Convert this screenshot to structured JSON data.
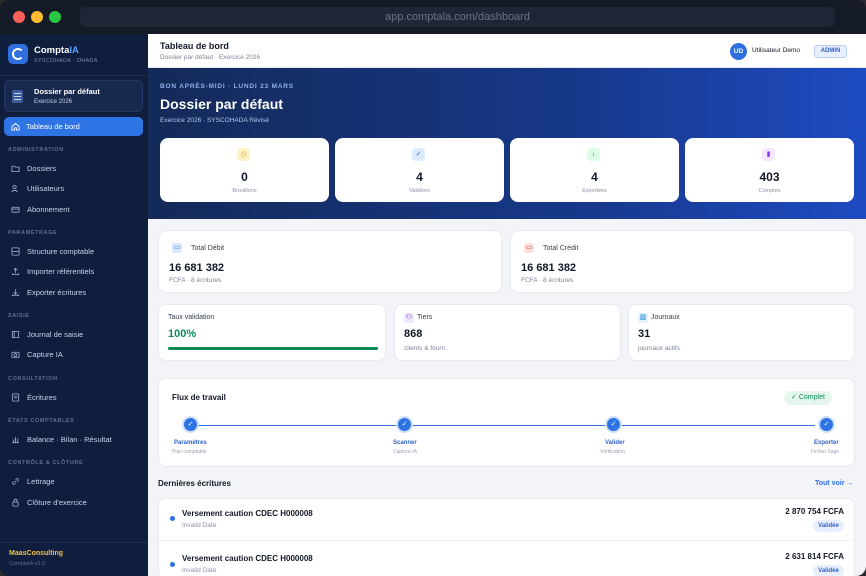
{
  "browser": {
    "url": "app.comptala.com/dashboard"
  },
  "colors": {
    "accent": "#2f74e4",
    "success": "#0b8a58",
    "brand_gold": "#f0c24a",
    "sidebar_bg": "#0f1e3d"
  },
  "sidebar": {
    "brand_name_main": "Compta",
    "brand_name_accent": "IA",
    "brand_sub": "SYSCOHADA · OHADA",
    "dossier_title": "Dossier par défaut",
    "dossier_sub": "Exercice 2026",
    "active_item": {
      "label": "Tableau de bord",
      "icon": "home-icon"
    },
    "sections": {
      "administration": "ADMINISTRATION",
      "parametrage": "PARAMÉTRAGE",
      "saisie": "SAISIE",
      "consultation": "CONSULTATION",
      "etats": "ÉTATS COMPTABLES",
      "controle": "CONTRÔLE & CLÔTURE"
    },
    "items": [
      {
        "label": "Dossiers",
        "icon": "folder-icon"
      },
      {
        "label": "Utilisateurs",
        "icon": "users-icon"
      },
      {
        "label": "Abonnement",
        "icon": "card-icon"
      },
      {
        "label": "Structure comptable",
        "icon": "structure-icon"
      },
      {
        "label": "Importer référentiels",
        "icon": "upload-icon"
      },
      {
        "label": "Exporter écritures",
        "icon": "download-icon"
      },
      {
        "label": "Journal de saisie",
        "icon": "book-icon"
      },
      {
        "label": "Capture IA",
        "icon": "camera-icon"
      },
      {
        "label": "Écritures",
        "icon": "list-icon"
      },
      {
        "label": "Balance · Bilan · Résultat",
        "icon": "chart-icon"
      },
      {
        "label": "Lettrage",
        "icon": "link-icon"
      },
      {
        "label": "Clôture d'exercice",
        "icon": "lock-icon"
      }
    ],
    "footer_name": "MaasConsulting",
    "footer_version": "ComptaIA v2.0"
  },
  "header": {
    "title": "Tableau de bord",
    "subtitle": "Dossier par défaut · Exercice 2026",
    "avatar_initials": "UD",
    "user_name": "Utilisateur Demo",
    "role_badge": "ADMIN"
  },
  "hero": {
    "greeting": "BON APRÈS-MIDI · LUNDI 23 MARS",
    "title": "Dossier par défaut",
    "subtitle": "Exercice 2026 · SYSCOHADA Révisé",
    "stats": [
      {
        "value": "0",
        "label": "Brouillons",
        "icon": "clock-icon",
        "color": "#f59e0b"
      },
      {
        "value": "4",
        "label": "Validées",
        "icon": "check-circle-icon",
        "color": "#2f74e4"
      },
      {
        "value": "4",
        "label": "Exportées",
        "icon": "download-icon",
        "color": "#16a34a"
      },
      {
        "value": "403",
        "label": "Comptes",
        "icon": "bars-icon",
        "color": "#9333ea"
      }
    ]
  },
  "totals": {
    "debit": {
      "label": "Total Débit",
      "value": "16 681 382",
      "sub": "FCFA · 8 écritures"
    },
    "credit": {
      "label": "Total Crédit",
      "value": "16 681 382",
      "sub": "FCFA · 8 écritures"
    }
  },
  "metrics": {
    "validation": {
      "label": "Taux validation",
      "value": "100%",
      "progress": 1.0
    },
    "tiers": {
      "label": "Tiers",
      "value": "868",
      "sub": "clients & fourn."
    },
    "journaux": {
      "label": "Journaux",
      "value": "31",
      "sub": "journaux actifs"
    }
  },
  "workflow": {
    "title": "Flux de travail",
    "status": "✓ Complet",
    "steps": [
      {
        "label": "Paramètres",
        "sub": "Plan comptable"
      },
      {
        "label": "Scanner",
        "sub": "Capture IA"
      },
      {
        "label": "Valider",
        "sub": "Vérification"
      },
      {
        "label": "Exporter",
        "sub": "Fichier Sage"
      }
    ]
  },
  "recent": {
    "title": "Dernières écritures",
    "see_all": "Tout voir →",
    "rows": [
      {
        "title": "Versement caution CDEC H000008",
        "date": "Invalid Date",
        "amount": "2 870 754 FCFA",
        "status": "Validée"
      },
      {
        "title": "Versement caution CDEC H000008",
        "date": "Invalid Date",
        "amount": "2 631 814 FCFA",
        "status": "Validée"
      }
    ]
  }
}
